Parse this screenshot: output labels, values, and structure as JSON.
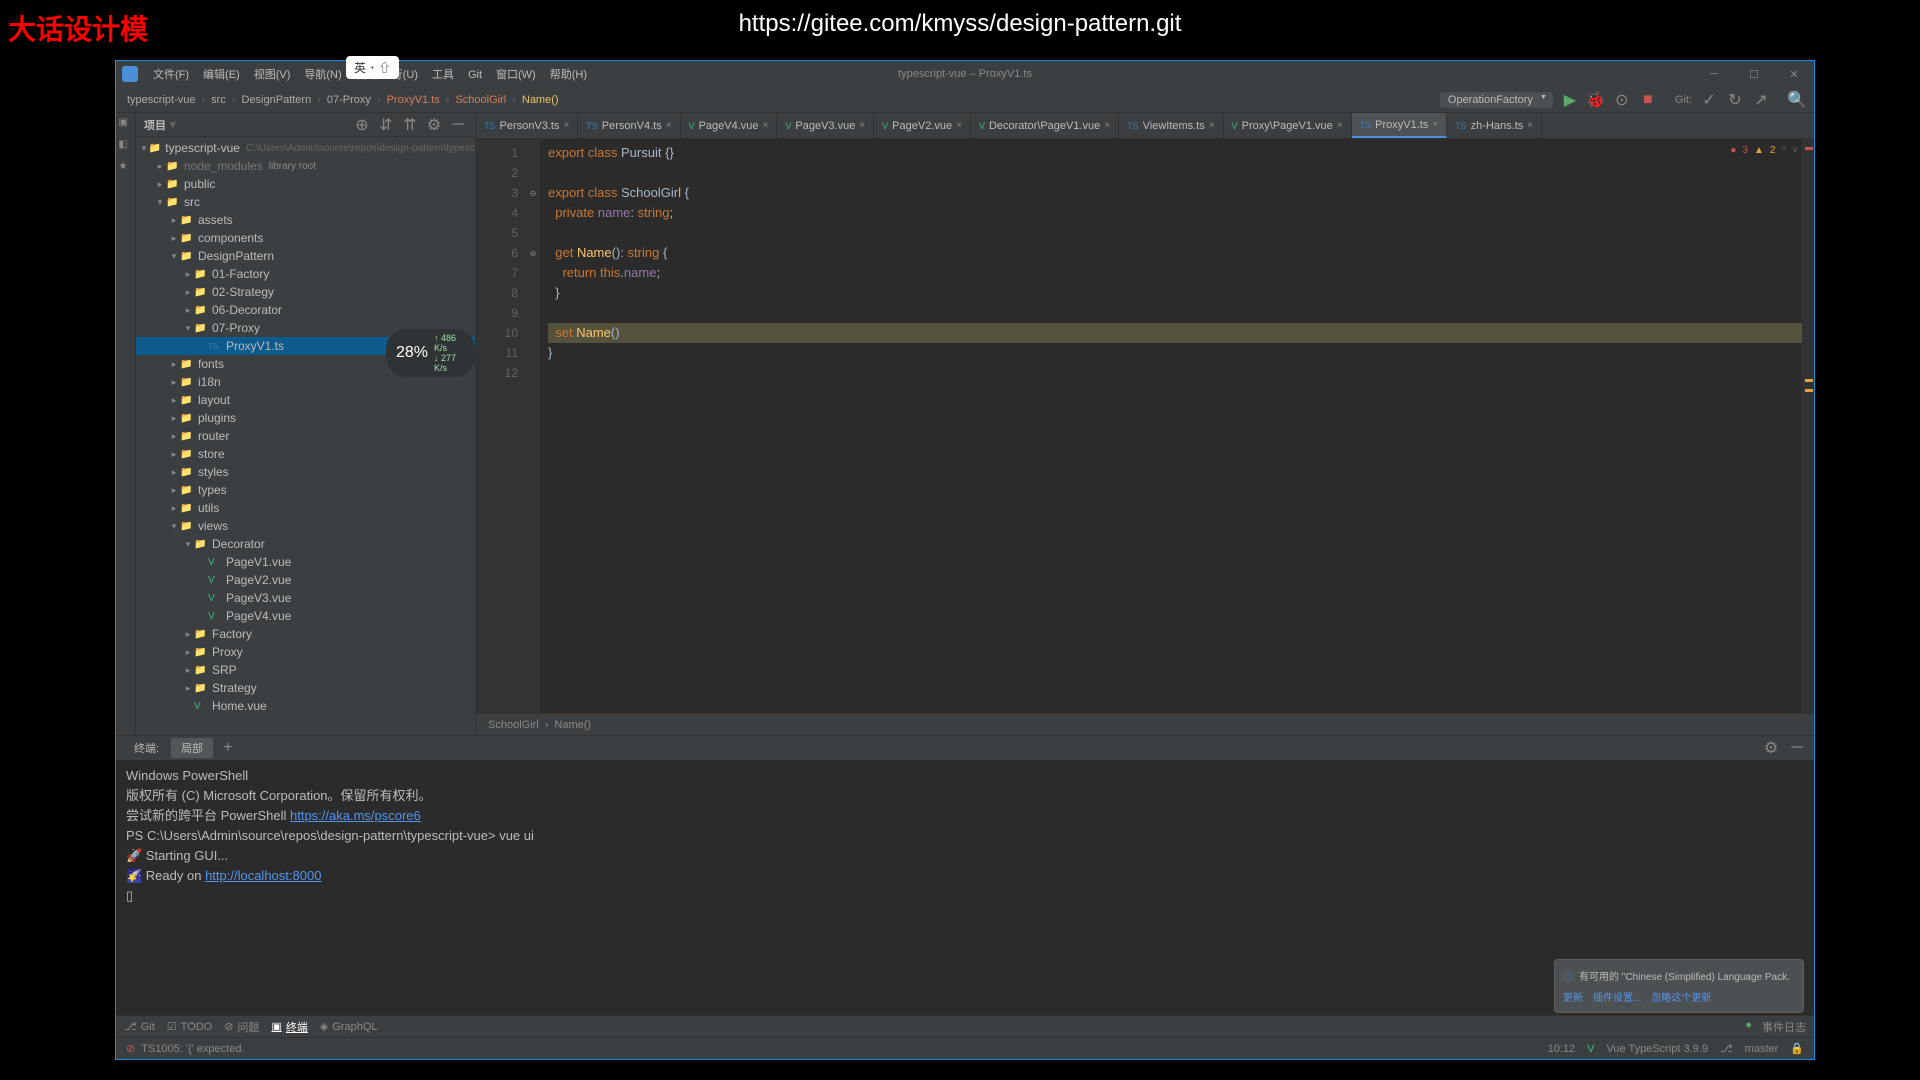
{
  "overlay": {
    "title": "大话设计模",
    "url": "https://gitee.com/kmyss/design-pattern.git",
    "input_method": "英 ･ ⇧"
  },
  "titlebar": {
    "menus": [
      "文件(F)",
      "编辑(E)",
      "视图(V)",
      "导航(N)",
      "代码",
      "行(U)",
      "工具",
      "Git",
      "窗口(W)",
      "帮助(H)"
    ],
    "center": "typescript-vue – ProxyV1.ts"
  },
  "nav": {
    "breadcrumb": [
      "typescript-vue",
      "src",
      "DesignPattern",
      "07-Proxy",
      "ProxyV1.ts",
      "SchoolGirl",
      "Name()"
    ],
    "run_config": "OperationFactory",
    "git_label": "Git:"
  },
  "project": {
    "header": "项目",
    "path": "C:\\Users\\Admin\\source\\repos\\design-pattern\\typesc",
    "tree": [
      {
        "depth": 0,
        "arrow": "▾",
        "icon": "folder",
        "name": "typescript-vue",
        "extra": "path",
        "sel": false
      },
      {
        "depth": 1,
        "arrow": "▸",
        "icon": "lib",
        "name": "node_modules",
        "extra": "library root",
        "dim": true
      },
      {
        "depth": 1,
        "arrow": "▸",
        "icon": "folder",
        "name": "public"
      },
      {
        "depth": 1,
        "arrow": "▾",
        "icon": "folder-src",
        "name": "src"
      },
      {
        "depth": 2,
        "arrow": "▸",
        "icon": "folder",
        "name": "assets"
      },
      {
        "depth": 2,
        "arrow": "▸",
        "icon": "folder",
        "name": "components"
      },
      {
        "depth": 2,
        "arrow": "▾",
        "icon": "folder",
        "name": "DesignPattern"
      },
      {
        "depth": 3,
        "arrow": "▸",
        "icon": "folder",
        "name": "01-Factory"
      },
      {
        "depth": 3,
        "arrow": "▸",
        "icon": "folder",
        "name": "02-Strategy"
      },
      {
        "depth": 3,
        "arrow": "▸",
        "icon": "folder",
        "name": "06-Decorator"
      },
      {
        "depth": 3,
        "arrow": "▾",
        "icon": "folder",
        "name": "07-Proxy"
      },
      {
        "depth": 4,
        "arrow": "",
        "icon": "ts",
        "name": "ProxyV1.ts",
        "sel": true
      },
      {
        "depth": 2,
        "arrow": "▸",
        "icon": "folder",
        "name": "fonts"
      },
      {
        "depth": 2,
        "arrow": "▸",
        "icon": "folder",
        "name": "i18n"
      },
      {
        "depth": 2,
        "arrow": "▸",
        "icon": "folder",
        "name": "layout"
      },
      {
        "depth": 2,
        "arrow": "▸",
        "icon": "folder",
        "name": "plugins"
      },
      {
        "depth": 2,
        "arrow": "▸",
        "icon": "folder",
        "name": "router"
      },
      {
        "depth": 2,
        "arrow": "▸",
        "icon": "folder",
        "name": "store"
      },
      {
        "depth": 2,
        "arrow": "▸",
        "icon": "folder",
        "name": "styles"
      },
      {
        "depth": 2,
        "arrow": "▸",
        "icon": "folder",
        "name": "types"
      },
      {
        "depth": 2,
        "arrow": "▸",
        "icon": "folder",
        "name": "utils"
      },
      {
        "depth": 2,
        "arrow": "▾",
        "icon": "folder",
        "name": "views"
      },
      {
        "depth": 3,
        "arrow": "▾",
        "icon": "folder",
        "name": "Decorator"
      },
      {
        "depth": 4,
        "arrow": "",
        "icon": "vue",
        "name": "PageV1.vue"
      },
      {
        "depth": 4,
        "arrow": "",
        "icon": "vue",
        "name": "PageV2.vue"
      },
      {
        "depth": 4,
        "arrow": "",
        "icon": "vue",
        "name": "PageV3.vue"
      },
      {
        "depth": 4,
        "arrow": "",
        "icon": "vue",
        "name": "PageV4.vue"
      },
      {
        "depth": 3,
        "arrow": "▸",
        "icon": "folder",
        "name": "Factory"
      },
      {
        "depth": 3,
        "arrow": "▸",
        "icon": "folder",
        "name": "Proxy"
      },
      {
        "depth": 3,
        "arrow": "▸",
        "icon": "folder",
        "name": "SRP"
      },
      {
        "depth": 3,
        "arrow": "▸",
        "icon": "folder",
        "name": "Strategy"
      },
      {
        "depth": 3,
        "arrow": "",
        "icon": "vue",
        "name": "Home.vue"
      }
    ]
  },
  "perf": {
    "cpu": "28%",
    "net1": "486 K/s",
    "net2": "277 K/s"
  },
  "tabs": [
    {
      "icon": "ts",
      "name": "PersonV3.ts"
    },
    {
      "icon": "ts",
      "name": "PersonV4.ts"
    },
    {
      "icon": "vue",
      "name": "PageV4.vue"
    },
    {
      "icon": "vue",
      "name": "PageV3.vue"
    },
    {
      "icon": "vue",
      "name": "PageV2.vue"
    },
    {
      "icon": "vue",
      "name": "Decorator\\PageV1.vue"
    },
    {
      "icon": "ts",
      "name": "ViewItems.ts"
    },
    {
      "icon": "vue",
      "name": "Proxy\\PageV1.vue"
    },
    {
      "icon": "ts",
      "name": "ProxyV1.ts",
      "active": true
    },
    {
      "icon": "ts",
      "name": "zh-Hans.ts"
    }
  ],
  "errors": {
    "red": "3",
    "yellow": "2"
  },
  "code": {
    "lines": [
      {
        "n": 1,
        "html": "<span class='kw'>export</span> <span class='kw'>class</span> <span class='cls'>Pursuit</span> <span class='paren'>{}</span>"
      },
      {
        "n": 2,
        "html": ""
      },
      {
        "n": 3,
        "html": "<span class='kw'>export</span> <span class='kw'>class</span> <span class='cls'>SchoolGirl</span> <span class='paren'>{</span>"
      },
      {
        "n": 4,
        "html": "  <span class='kw'>private</span> <span class='ident'>name</span><span class='paren'>:</span> <span class='type'>string</span><span class='paren'>;</span>"
      },
      {
        "n": 5,
        "html": ""
      },
      {
        "n": 6,
        "html": "  <span class='kw'>get</span> <span class='method'>Name</span><span class='paren'>():</span> <span class='type'>string</span> <span class='paren'>{</span>"
      },
      {
        "n": 7,
        "html": "    <span class='kw'>return</span> <span class='this'>this</span><span class='paren'>.</span><span class='ident'>name</span><span class='paren'>;</span>"
      },
      {
        "n": 8,
        "html": "  <span class='paren'>}</span>"
      },
      {
        "n": 9,
        "html": ""
      },
      {
        "n": 10,
        "html": "  <span class='kw'>set</span> <span class='method'>Name</span><span class='paren'>()</span>",
        "hl": true,
        "bulb": true
      },
      {
        "n": 11,
        "html": "<span class='paren'>}</span>"
      },
      {
        "n": 12,
        "html": ""
      }
    ],
    "bottom_crumb": [
      "SchoolGirl",
      "Name()"
    ]
  },
  "bottom_panel": {
    "tabs": [
      "终端:",
      "局部"
    ],
    "terminal": [
      {
        "t": "Windows PowerShell"
      },
      {
        "t": "版权所有 (C) Microsoft Corporation。保留所有权利。"
      },
      {
        "t": ""
      },
      {
        "parts": [
          {
            "t": "尝试新的跨平台 PowerShell "
          },
          {
            "t": "https://aka.ms/pscore6",
            "link": true
          }
        ]
      },
      {
        "t": ""
      },
      {
        "parts": [
          {
            "t": "PS C:\\Users\\Admin\\source\\repos\\design-pattern\\typescript-vue> "
          },
          {
            "t": "vue ui",
            "cmd": true
          }
        ]
      },
      {
        "t": "🚀  Starting GUI..."
      },
      {
        "parts": [
          {
            "t": "🌠  Ready on "
          },
          {
            "t": "http://localhost:8000",
            "link": true
          }
        ]
      },
      {
        "t": "▯"
      }
    ]
  },
  "tools": [
    {
      "icon": "⎇",
      "label": "Git"
    },
    {
      "icon": "☑",
      "label": "TODO"
    },
    {
      "icon": "⊘",
      "label": "问题"
    },
    {
      "icon": "▣",
      "label": "终端",
      "active": true
    },
    {
      "icon": "◈",
      "label": "GraphQL"
    }
  ],
  "tools_right": {
    "event_log": "事件日志"
  },
  "status": {
    "left": "TS1005: '{' expected.",
    "cursor": "10:12",
    "lang": "Vue TypeScript 3.9.9",
    "branch": "master"
  },
  "notification": {
    "title": "有可用的 \"Chinese (Simplified) Language Pack.",
    "links": [
      "更新",
      "插件设置...",
      "忽略这个更新"
    ]
  }
}
